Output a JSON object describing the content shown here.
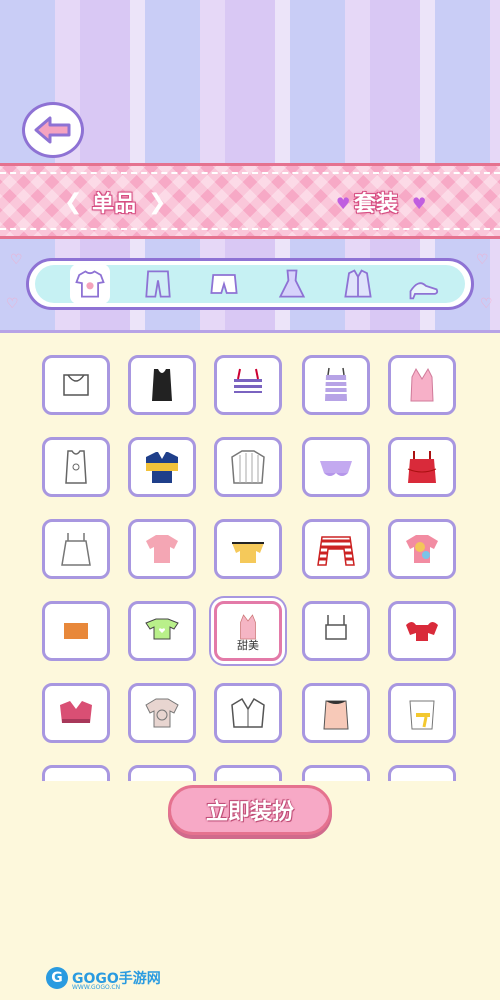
{
  "tabs": {
    "single": "单品",
    "outfit": "套装"
  },
  "categories": [
    "tops-icon",
    "pants-icon",
    "shorts-icon",
    "dress-icon",
    "jacket-icon",
    "shoes-icon"
  ],
  "selected_item_label": "甜美",
  "action_button": "立即装扮",
  "watermark": {
    "brand": "GOGO手游网",
    "url": "WWW.GOGO.CN"
  },
  "colors": {
    "accent_purple": "#8e72d4",
    "banner_pink": "#f7a9c6",
    "cream_bg": "#fdf8dc"
  }
}
